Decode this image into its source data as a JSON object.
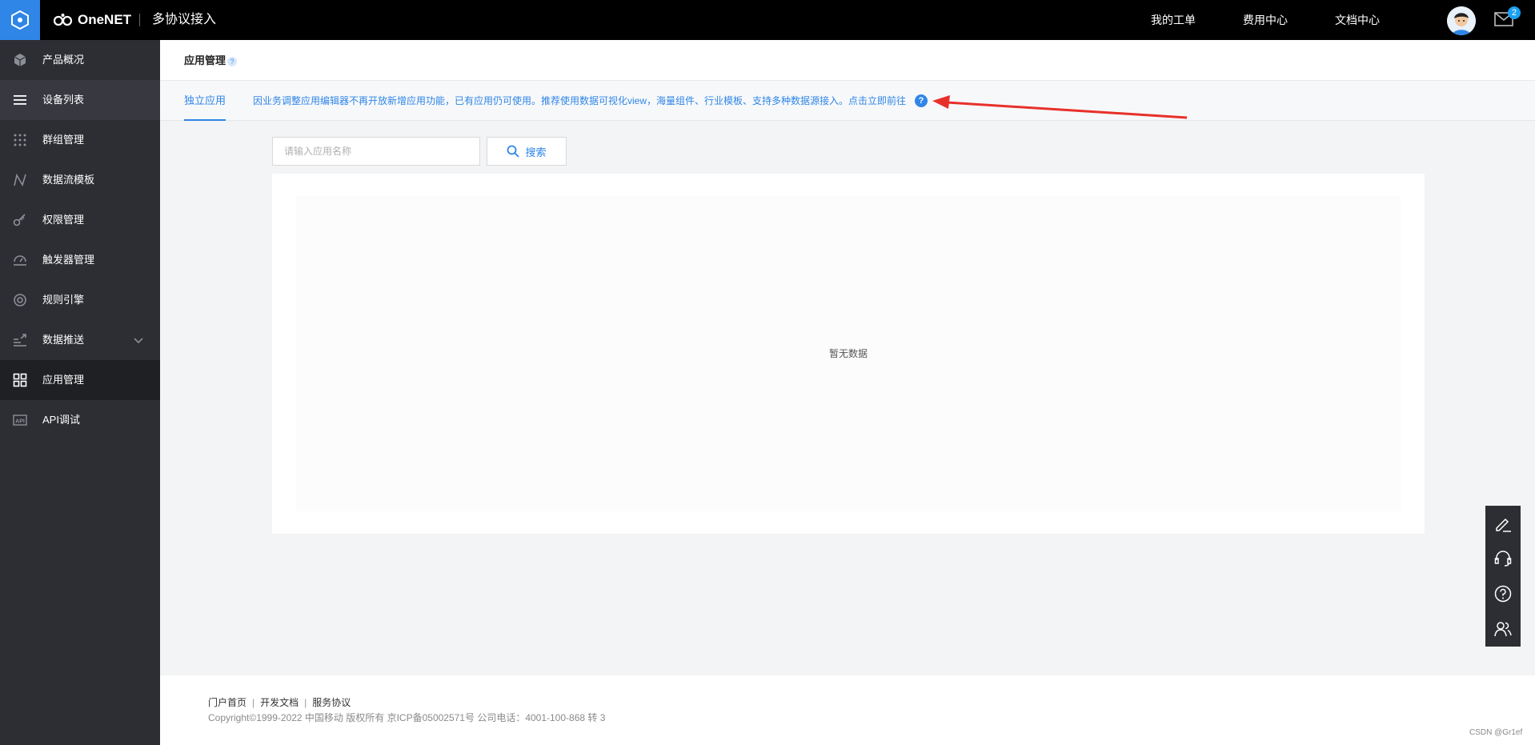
{
  "header": {
    "brand": "OneNET",
    "product_title": "多协议接入",
    "nav": [
      "我的工单",
      "费用中心",
      "文档中心"
    ],
    "mail_badge": "2"
  },
  "sidebar": {
    "items": [
      {
        "label": "产品概况",
        "icon": "cube-icon"
      },
      {
        "label": "设备列表",
        "icon": "list-icon"
      },
      {
        "label": "群组管理",
        "icon": "grid-dots-icon"
      },
      {
        "label": "数据流模板",
        "icon": "flow-icon"
      },
      {
        "label": "权限管理",
        "icon": "key-icon"
      },
      {
        "label": "触发器管理",
        "icon": "trigger-icon"
      },
      {
        "label": "规则引擎",
        "icon": "rule-engine-icon"
      },
      {
        "label": "数据推送",
        "icon": "push-icon"
      },
      {
        "label": "应用管理",
        "icon": "apps-icon"
      },
      {
        "label": "API调试",
        "icon": "api-icon"
      }
    ],
    "active_index": 8
  },
  "page": {
    "title": "应用管理",
    "tab": "独立应用",
    "notice": "因业务调整应用编辑器不再开放新增应用功能，已有应用仍可使用。推荐使用数据可视化view，海量组件、行业模板、支持多种数据源接入。点击立即前往"
  },
  "search": {
    "placeholder": "请输入应用名称",
    "button_label": "搜索"
  },
  "table": {
    "empty_text": "暂无数据"
  },
  "footer": {
    "links": [
      "门户首页",
      "开发文档",
      "服务协议"
    ],
    "copyright": "Copyright©1999-2022 中国移动 版权所有 京ICP备05002571号 公司电话：4001-100-868 转 3"
  },
  "watermark": "CSDN @Gr1ef",
  "colors": {
    "accent": "#2f86e7",
    "topbar": "#000000",
    "sidebar": "#2d2e33",
    "annotation_arrow": "#e8302a"
  }
}
